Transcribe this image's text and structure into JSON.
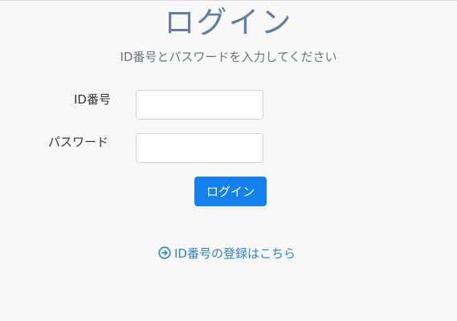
{
  "login": {
    "title": "ログイン",
    "subtitle": "ID番号とパスワードを入力してください",
    "id_label": "ID番号",
    "id_value": "",
    "password_label": "パスワード",
    "password_value": "",
    "submit_label": "ログイン",
    "register_link": "ID番号の登録はこちら",
    "register_icon": "arrow-circle-right-icon",
    "accent_color": "#1481ee",
    "link_color": "#2a82d6",
    "title_color": "#5f7fa3"
  }
}
